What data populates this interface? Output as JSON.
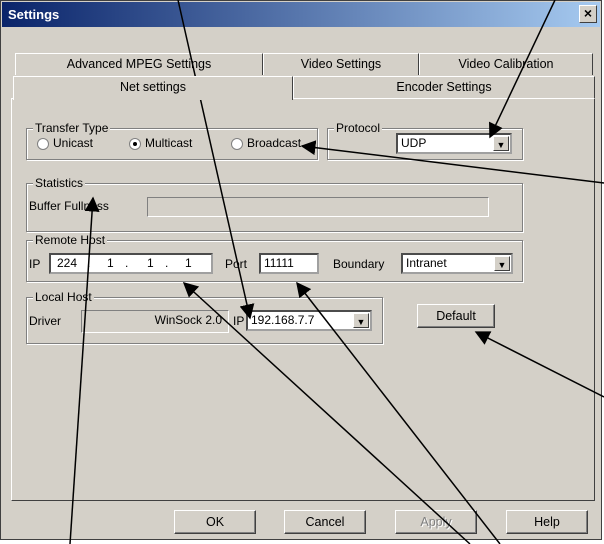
{
  "window": {
    "title": "Settings",
    "close_glyph": "×"
  },
  "tabs": [
    {
      "label": "Advanced MPEG Settings"
    },
    {
      "label": "Video Settings"
    },
    {
      "label": "Video Calibration"
    },
    {
      "label": "Net settings"
    },
    {
      "label": "Encoder Settings"
    }
  ],
  "transfer": {
    "label": "Transfer Type",
    "options": [
      "Unicast",
      "Multicast",
      "Broadcast"
    ],
    "selected": "Multicast"
  },
  "protocol": {
    "label": "Protocol",
    "value": "UDP"
  },
  "statistics": {
    "label": "Statistics",
    "buffer_label": "Buffer Fullness",
    "buffer_fullness": 0
  },
  "remote_host": {
    "label": "Remote Host",
    "ip_label": "IP",
    "ip_octets": [
      "224",
      "1",
      "1",
      "1"
    ],
    "port_label": "Port",
    "port": "11111",
    "boundary_label": "Boundary",
    "boundary": "Intranet"
  },
  "local_host": {
    "label": "Local Host",
    "driver_label": "Driver",
    "driver": "WinSock 2.0",
    "ip_label": "IP",
    "ip": "192.168.7.7"
  },
  "buttons": {
    "default": "Default",
    "ok": "OK",
    "cancel": "Cancel",
    "apply": "Apply",
    "help": "Help"
  },
  "icons": {
    "dropdown": "dropdown-arrow-icon",
    "close": "close-icon"
  },
  "colors": {
    "face": "#d4d0c8",
    "title_start": "#0a246a",
    "title_end": "#a6caf0"
  }
}
